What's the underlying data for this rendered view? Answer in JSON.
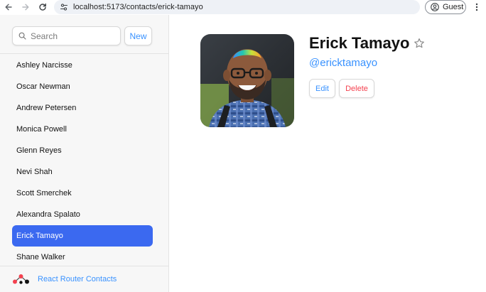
{
  "browser": {
    "url": "localhost:5173/contacts/erick-tamayo",
    "profile_label": "Guest"
  },
  "sidebar": {
    "search_placeholder": "Search",
    "new_label": "New",
    "contacts": [
      {
        "name": "Ashley Narcisse",
        "active": false
      },
      {
        "name": "Oscar Newman",
        "active": false
      },
      {
        "name": "Andrew Petersen",
        "active": false
      },
      {
        "name": "Monica Powell",
        "active": false
      },
      {
        "name": "Glenn Reyes",
        "active": false
      },
      {
        "name": "Nevi Shah",
        "active": false
      },
      {
        "name": "Scott Smerchek",
        "active": false
      },
      {
        "name": "Alexandra Spalato",
        "active": false
      },
      {
        "name": "Erick Tamayo",
        "active": true
      },
      {
        "name": "Shane Walker",
        "active": false
      }
    ],
    "footer_link": "React Router Contacts"
  },
  "detail": {
    "name": "Erick Tamayo",
    "handle": "@ericktamayo",
    "favorite": false,
    "edit_label": "Edit",
    "delete_label": "Delete"
  },
  "colors": {
    "accent": "#3992ff",
    "active_item": "#3b69f0",
    "danger": "#f44250"
  },
  "icons": [
    "back-arrow-icon",
    "forward-arrow-icon",
    "reload-icon",
    "site-info-icon",
    "profile-icon",
    "more-menu-icon",
    "search-icon",
    "star-icon",
    "react-router-logo"
  ]
}
